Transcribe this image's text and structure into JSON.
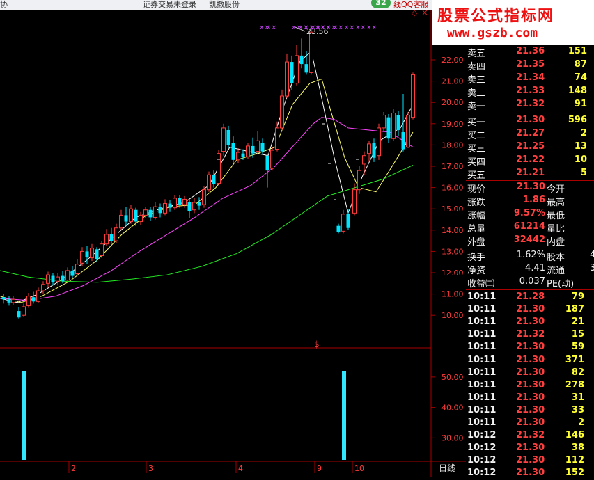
{
  "topbar": {
    "left_fragment": "协",
    "trade_status": "证券交易未登录",
    "company": "凯撒股份",
    "qq_count": "32",
    "qq_service": "线QQ客服"
  },
  "window_controls": {
    "restore": "◇",
    "close": "×"
  },
  "logo": {
    "title": "股票公式指标网",
    "url": "www.gszb.com"
  },
  "chart": {
    "high_label": "23.56",
    "special_marker": "$",
    "top_markers": "××",
    "price_axis": [
      "22.00",
      "21.00",
      "20.00",
      "19.00",
      "18.00",
      "17.00",
      "16.00",
      "15.00",
      "14.00",
      "13.00",
      "12.00",
      "11.00",
      "10.00"
    ],
    "vol_axis": [
      "50.00",
      "40.00",
      "30.00"
    ],
    "x_labels": [
      "2",
      "3",
      "4",
      "9",
      "10"
    ],
    "period_label": "日线",
    "colors": {
      "up": "#ff3c3c",
      "down": "#00e5ff",
      "ma5": "#ffffff",
      "ma10": "#ffff66",
      "ma20": "#ff44ff",
      "ma60": "#22ee22",
      "grid": "#aa0000",
      "vol": "#33e6ff",
      "marker": "#cc44ff"
    }
  },
  "chart_data": {
    "type": "candlestick",
    "x": [
      "2",
      "3",
      "4",
      "9",
      "10"
    ],
    "price_range": [
      9.6,
      24.0
    ],
    "high": 23.56,
    "volume_range": [
      23,
      55
    ],
    "volume_bars": [
      52,
      52
    ]
  },
  "orderbook": {
    "asks": [
      {
        "label": "卖五",
        "price": "21.36",
        "vol": "151"
      },
      {
        "label": "卖四",
        "price": "21.35",
        "vol": "87"
      },
      {
        "label": "卖三",
        "price": "21.34",
        "vol": "74"
      },
      {
        "label": "卖二",
        "price": "21.33",
        "vol": "148"
      },
      {
        "label": "卖一",
        "price": "21.32",
        "vol": "91"
      }
    ],
    "bids": [
      {
        "label": "买一",
        "price": "21.30",
        "vol": "596"
      },
      {
        "label": "买二",
        "price": "21.27",
        "vol": "2"
      },
      {
        "label": "买三",
        "price": "21.25",
        "vol": "13"
      },
      {
        "label": "买四",
        "price": "21.22",
        "vol": "10"
      },
      {
        "label": "买五",
        "price": "21.21",
        "vol": "5"
      }
    ]
  },
  "quote": {
    "rows": [
      {
        "l1": "现价",
        "v1": "21.30",
        "l2": "今开"
      },
      {
        "l1": "涨跌",
        "v1": "1.86",
        "l2": "最高"
      },
      {
        "l1": "涨幅",
        "v1": "9.57%",
        "l2": "最低"
      },
      {
        "l1": "总量",
        "v1": "61214",
        "l2": "量比"
      },
      {
        "l1": "外盘",
        "v1": "32442",
        "l2": "内盘"
      }
    ],
    "info": [
      {
        "l1": "换手",
        "v1": "1.62%",
        "l2": "股本",
        "v2": "4"
      },
      {
        "l1": "净资",
        "v1": "4.41",
        "l2": "流通",
        "v2": "3"
      },
      {
        "l1": "收益㈡",
        "v1": "0.037",
        "l2": "PE(动)",
        "v2": ""
      }
    ]
  },
  "ticks": [
    {
      "time": "10:11",
      "price": "21.28",
      "vol": "79"
    },
    {
      "time": "10:11",
      "price": "21.30",
      "vol": "187"
    },
    {
      "time": "10:11",
      "price": "21.30",
      "vol": "21"
    },
    {
      "time": "10:11",
      "price": "21.32",
      "vol": "15"
    },
    {
      "time": "10:11",
      "price": "21.30",
      "vol": "59"
    },
    {
      "time": "10:11",
      "price": "21.30",
      "vol": "371"
    },
    {
      "time": "10:11",
      "price": "21.30",
      "vol": "82"
    },
    {
      "time": "10:11",
      "price": "21.30",
      "vol": "278"
    },
    {
      "time": "10:11",
      "price": "21.30",
      "vol": "31"
    },
    {
      "time": "10:11",
      "price": "21.30",
      "vol": "33"
    },
    {
      "time": "10:11",
      "price": "21.30",
      "vol": "2"
    },
    {
      "time": "10:12",
      "price": "21.32",
      "vol": "146"
    },
    {
      "time": "10:12",
      "price": "21.30",
      "vol": "38"
    },
    {
      "time": "10:12",
      "price": "21.30",
      "vol": "112"
    },
    {
      "time": "10:12",
      "price": "21.30",
      "vol": "152"
    }
  ]
}
